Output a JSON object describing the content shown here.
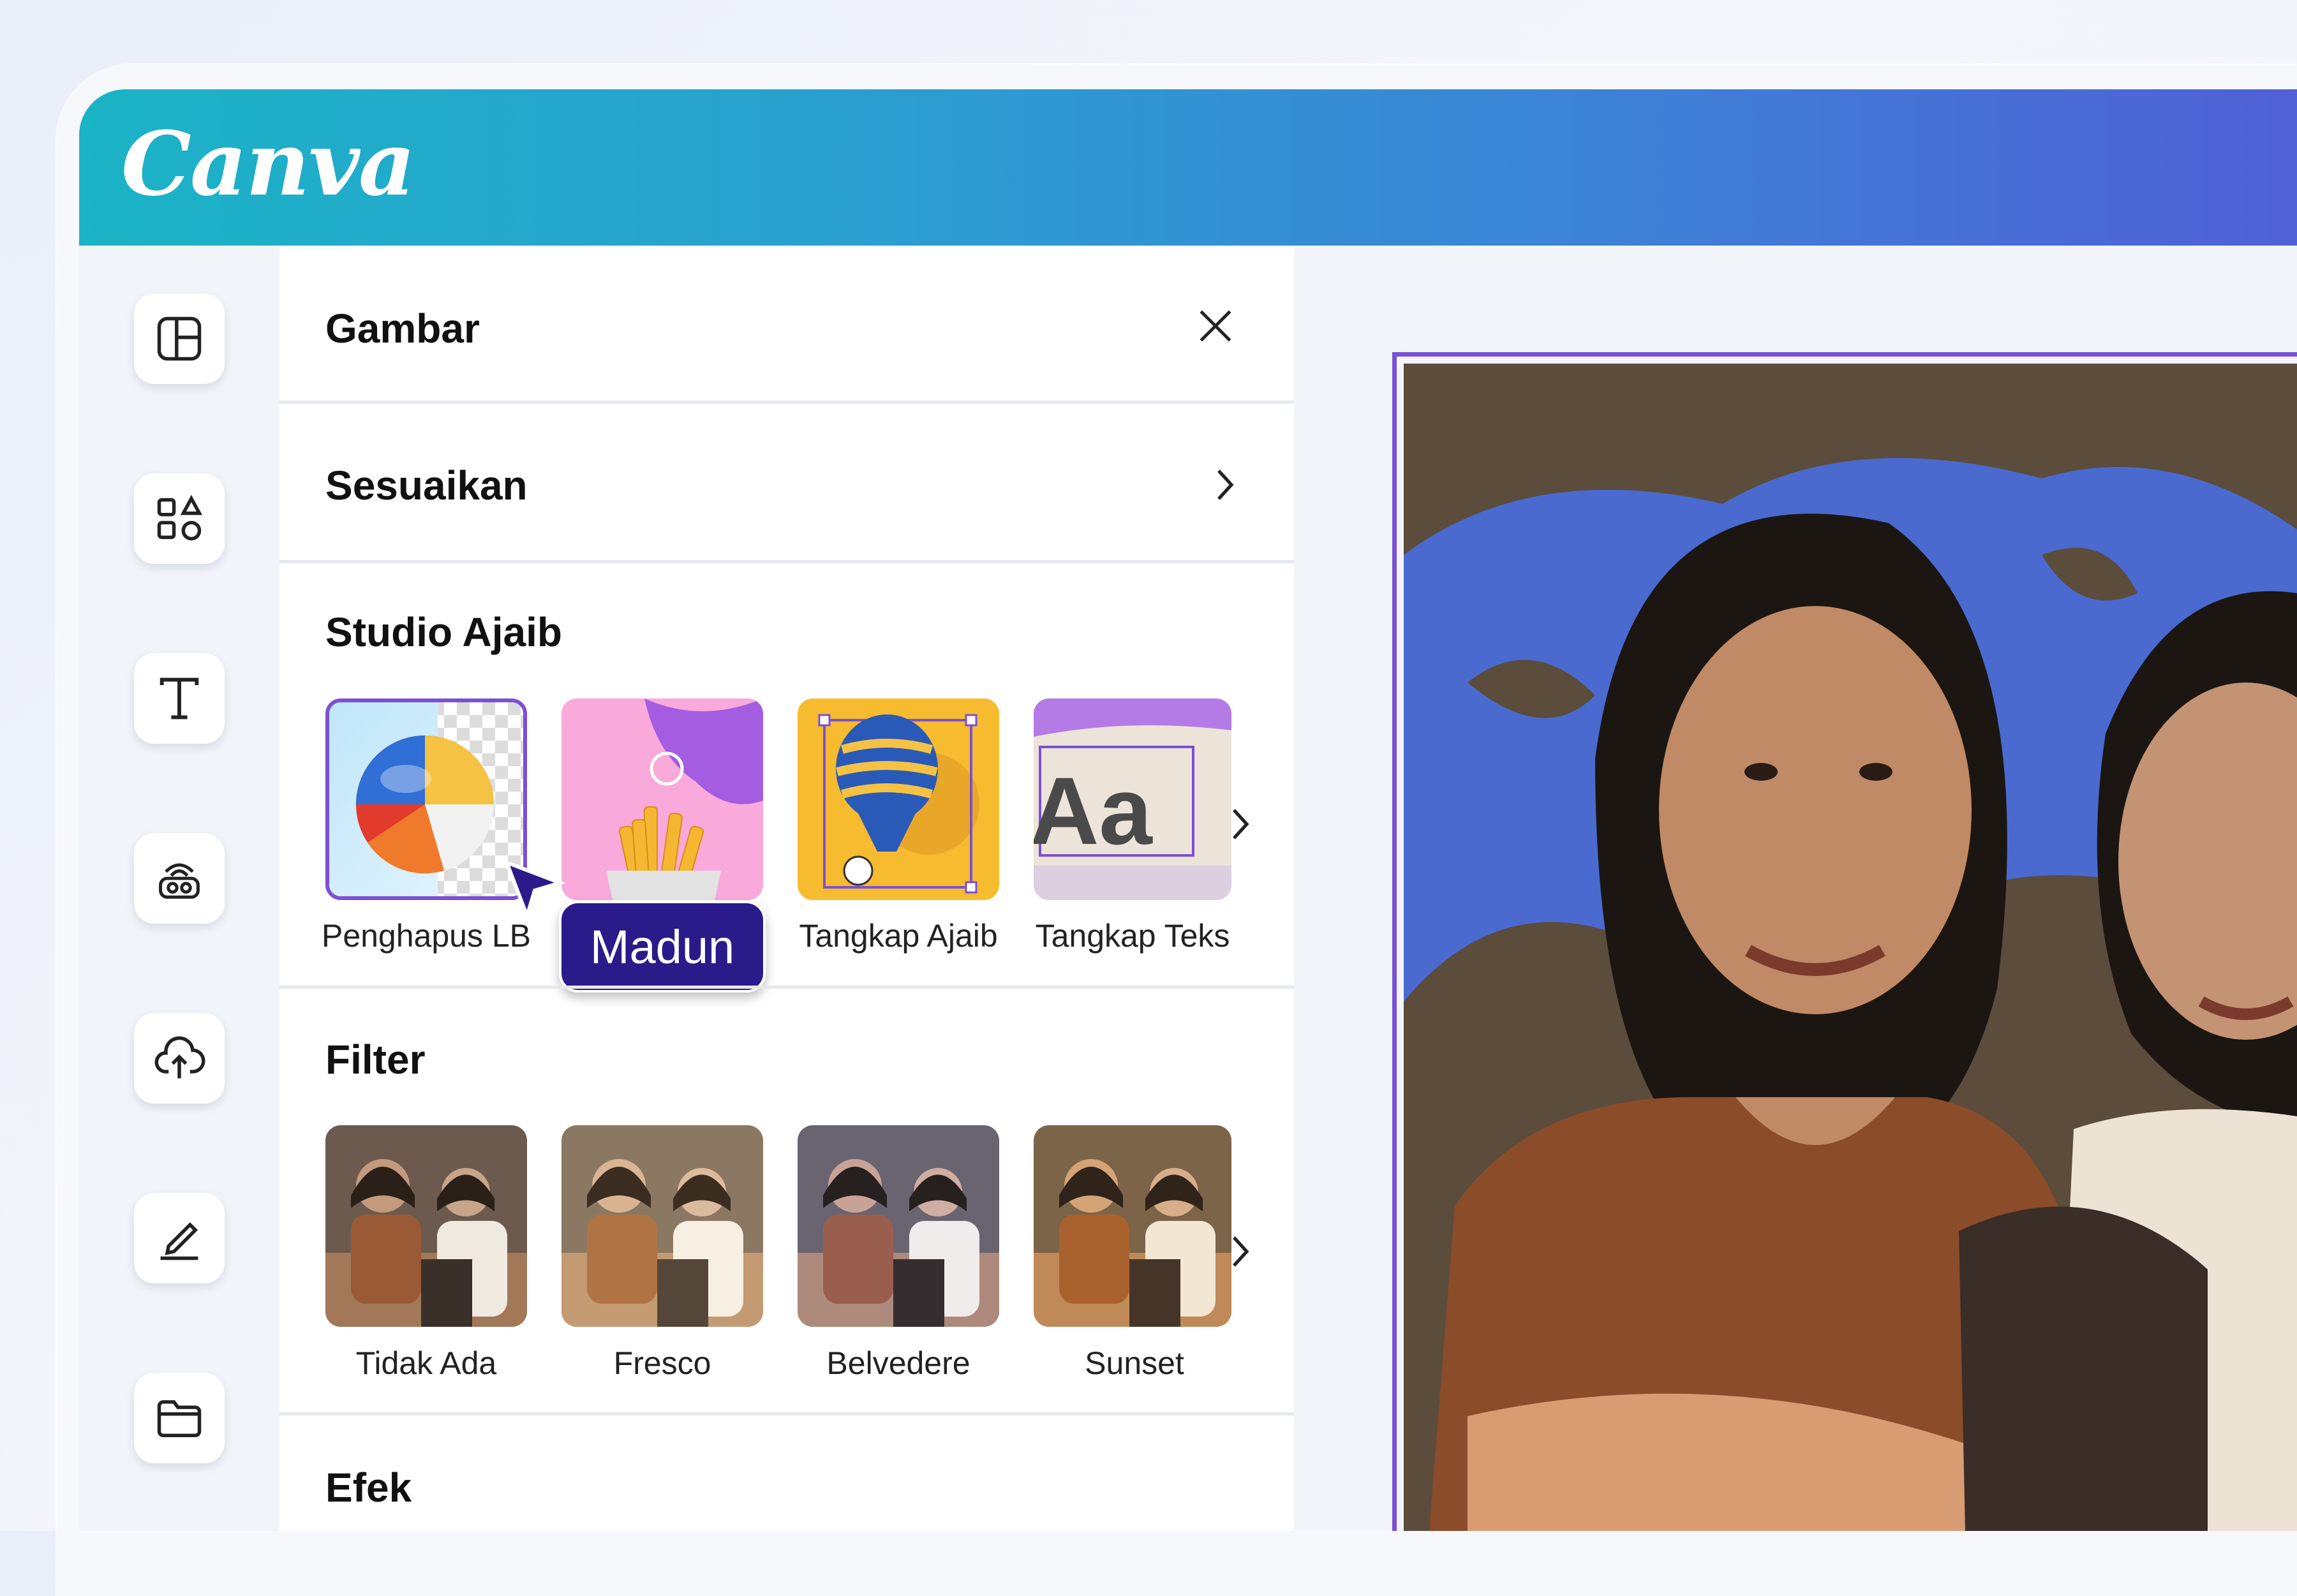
{
  "app": {
    "logo_text": "Canva"
  },
  "panel": {
    "title": "Gambar",
    "adjust_label": "Sesuaikan",
    "magic_studio": {
      "heading": "Studio Ajaib",
      "items": [
        {
          "label": "Penghapus LB"
        },
        {
          "label": "Madun"
        },
        {
          "label": "Tangkap Ajaib"
        },
        {
          "label": "Tangkap Teks"
        }
      ],
      "tooltip": "Madun"
    },
    "filter": {
      "heading": "Filter",
      "items": [
        {
          "label": "Tidak Ada"
        },
        {
          "label": "Fresco"
        },
        {
          "label": "Belvedere"
        },
        {
          "label": "Sunset"
        }
      ]
    },
    "effects_heading": "Efek"
  },
  "tile_aa_text": "Aa",
  "colors": {
    "header_start": "#1bb3c6",
    "header_end": "#5060d6",
    "selection": "#7b4fd6",
    "tooltip_bg": "#2b1a8a"
  },
  "icons": [
    "layout-icon",
    "elements-icon",
    "text-icon",
    "brand-icon",
    "upload-icon",
    "draw-icon",
    "folder-icon",
    "close-icon",
    "chevron-right-icon"
  ]
}
